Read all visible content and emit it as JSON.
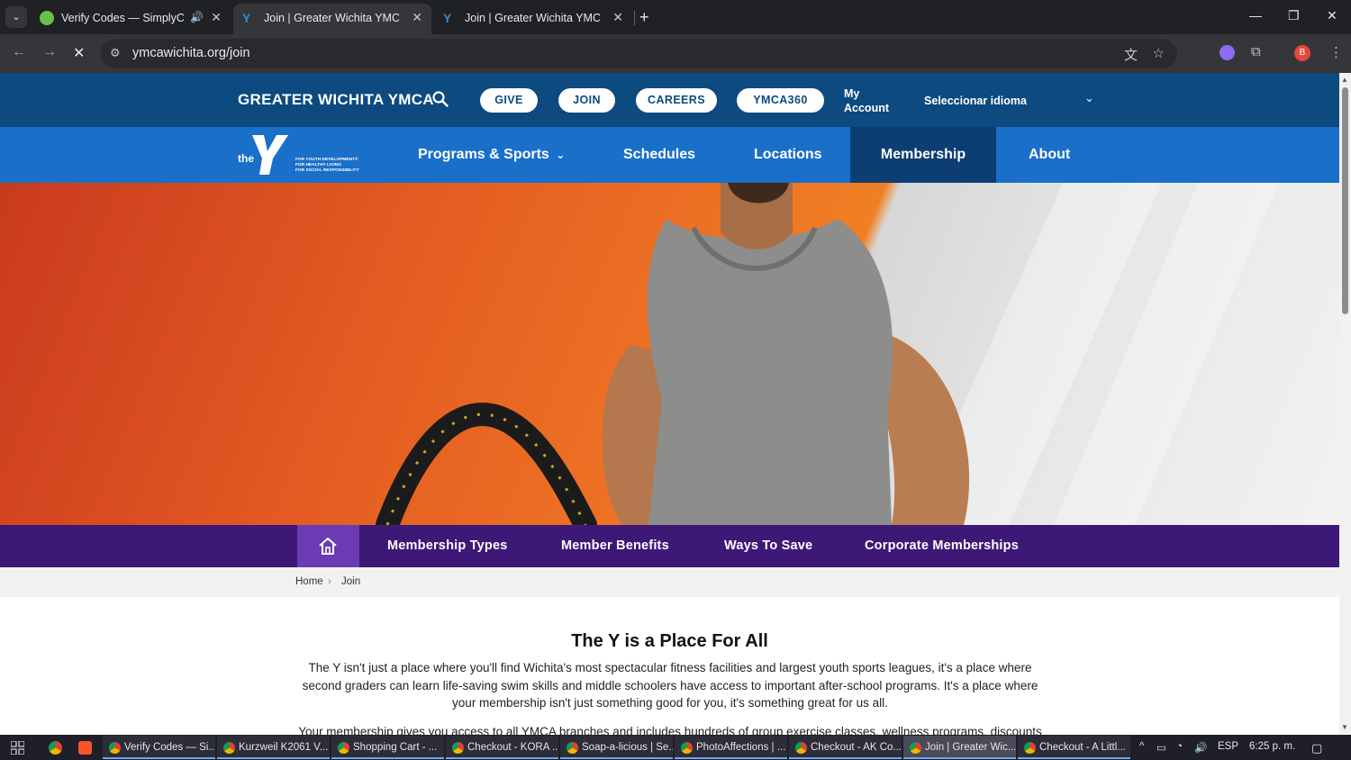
{
  "browser": {
    "tabs": [
      {
        "title": "Verify Codes — SimplyCode",
        "active": false
      },
      {
        "title": "Join | Greater Wichita YMCA",
        "active": true
      },
      {
        "title": "Join | Greater Wichita YMCA",
        "active": false
      }
    ],
    "url": "ymcawichita.org/join",
    "profile_initial": "B"
  },
  "site": {
    "brand": "GREATER WICHITA YMCA",
    "util_buttons": [
      "GIVE",
      "JOIN",
      "CAREERS",
      "YMCA360"
    ],
    "my_account": "My Account",
    "language_select": "Seleccionar idioma",
    "logo": {
      "the": "the",
      "tagline": [
        "FOR YOUTH DEVELOPMENT®",
        "FOR HEALTHY LIVING",
        "FOR SOCIAL RESPONSIBILITY"
      ]
    },
    "main_nav": [
      "Programs & Sports",
      "Schedules",
      "Locations",
      "Membership",
      "About"
    ],
    "sub_nav": [
      "Membership Types",
      "Member Benefits",
      "Ways To Save",
      "Corporate Memberships"
    ],
    "breadcrumb": [
      "Home",
      "Join"
    ],
    "heading": "The Y is a Place For All",
    "paragraph1": "The Y isn't just a place where you'll find Wichita's most spectacular fitness facilities and largest youth sports leagues, it's a place where second graders can learn life-saving swim skills and middle schoolers have access to important after-school programs. It's a place where your membership isn't just something good for you, it's something great for us all.",
    "paragraph2": "Your membership gives you access to all YMCA branches and includes hundreds of group exercise classes, wellness programs, discounts"
  },
  "taskbar": {
    "apps": [
      "Verify Codes — Si...",
      "Kurzweil K2061 V...",
      "Shopping Cart - ...",
      "Checkout - KORA ...",
      "Soap-a-licious | Se...",
      "PhotoAffections | ...",
      "Checkout - AK Co...",
      "Join | Greater Wic...",
      "Checkout - A Littl..."
    ],
    "language": "ESP",
    "time": "6:25 p. m."
  },
  "colors": {
    "util_bar": "#0c4a80",
    "main_nav": "#1a6fc9",
    "sub_nav": "#3e1877",
    "accent_purple": "#6a3bb2"
  }
}
